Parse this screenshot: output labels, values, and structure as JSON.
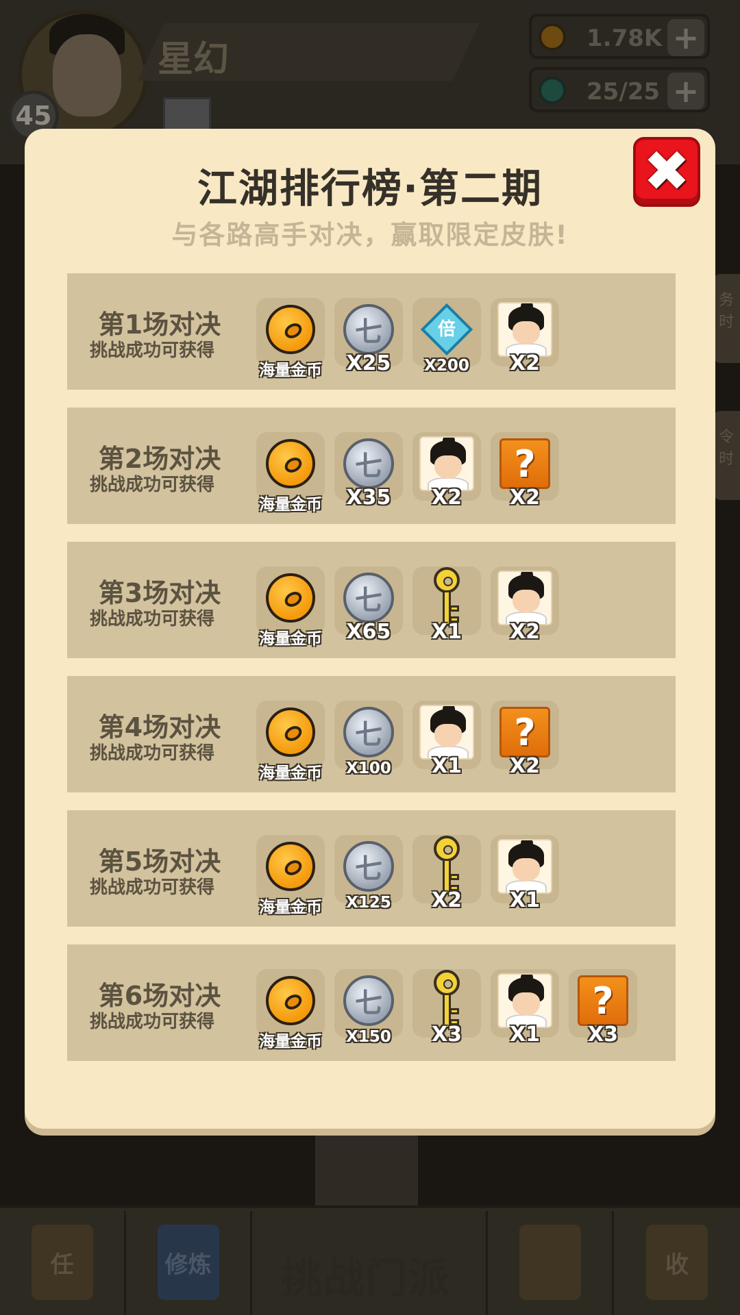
{
  "background": {
    "player": {
      "name": "星幻",
      "level": "45"
    },
    "resources": {
      "coins": "1.78K",
      "energy": "25/25"
    },
    "side_tabs": [
      "务时",
      "令时"
    ],
    "bottom_nav": {
      "tasks_label": "任",
      "cultivate_label": "修炼",
      "challenge_label": "挑战门派",
      "shop_label": "收"
    }
  },
  "modal": {
    "title": "江湖排行榜·第二期",
    "subtitle": "与各路高手对决，赢取限定皮肤!",
    "close_icon": "close-x-icon",
    "accent_color": "#e9141c",
    "rounds": [
      {
        "title": "第1场对决",
        "subtitle": "挑战成功可获得",
        "rewards": [
          {
            "icon": "gold-coin-icon",
            "label": "海量金币"
          },
          {
            "icon": "silver-coin-icon",
            "label": "X25"
          },
          {
            "icon": "diamond-multiplier-icon",
            "label": "X200"
          },
          {
            "icon": "hero-skin-fragment-icon",
            "label": "X2"
          }
        ]
      },
      {
        "title": "第2场对决",
        "subtitle": "挑战成功可获得",
        "rewards": [
          {
            "icon": "gold-coin-icon",
            "label": "海量金币"
          },
          {
            "icon": "silver-coin-icon",
            "label": "X35"
          },
          {
            "icon": "hero-skin-fragment-icon",
            "label": "X2"
          },
          {
            "icon": "mystery-fragment-icon",
            "label": "X2"
          }
        ]
      },
      {
        "title": "第3场对决",
        "subtitle": "挑战成功可获得",
        "rewards": [
          {
            "icon": "gold-coin-icon",
            "label": "海量金币"
          },
          {
            "icon": "silver-coin-icon",
            "label": "X65"
          },
          {
            "icon": "golden-key-icon",
            "label": "X1"
          },
          {
            "icon": "hero-skin-fragment-icon",
            "label": "X2"
          }
        ]
      },
      {
        "title": "第4场对决",
        "subtitle": "挑战成功可获得",
        "rewards": [
          {
            "icon": "gold-coin-icon",
            "label": "海量金币"
          },
          {
            "icon": "silver-coin-icon",
            "label": "X100"
          },
          {
            "icon": "hero-skin-fragment-icon",
            "label": "X1"
          },
          {
            "icon": "mystery-outfit-icon",
            "label": "X2"
          }
        ]
      },
      {
        "title": "第5场对决",
        "subtitle": "挑战成功可获得",
        "rewards": [
          {
            "icon": "gold-coin-icon",
            "label": "海量金币"
          },
          {
            "icon": "silver-coin-icon",
            "label": "X125"
          },
          {
            "icon": "golden-key-icon",
            "label": "X2"
          },
          {
            "icon": "hero-skin-fragment-icon",
            "label": "X1"
          }
        ]
      },
      {
        "title": "第6场对决",
        "subtitle": "挑战成功可获得",
        "rewards": [
          {
            "icon": "gold-coin-icon",
            "label": "海量金币"
          },
          {
            "icon": "silver-coin-icon",
            "label": "X150"
          },
          {
            "icon": "golden-key-icon",
            "label": "X3"
          },
          {
            "icon": "hero-skin-fragment-icon",
            "label": "X1"
          },
          {
            "icon": "mystery-weapon-icon",
            "label": "X3"
          }
        ]
      }
    ]
  }
}
